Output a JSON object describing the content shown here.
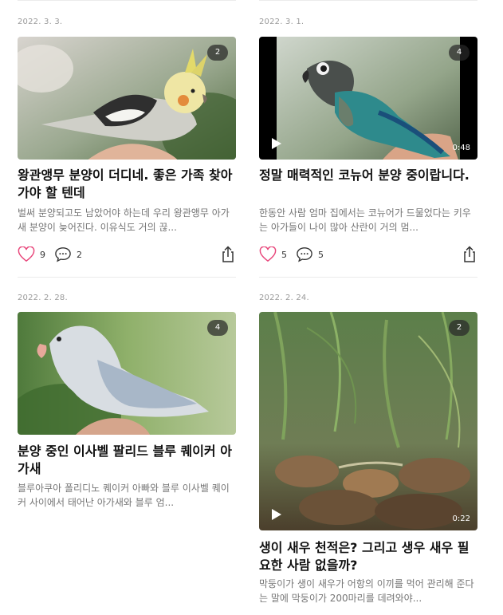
{
  "posts": [
    {
      "date": "2022. 3. 3.",
      "image_count": "2",
      "title": "왕관앵무 분양이 더디네. 좋은 가족 찾아가야 할 텐데",
      "excerpt": "벌써 분양되고도 남았어야 하는데 우리 왕관앵무 아가새 분양이 늦어진다. 이유식도 거의 끊...",
      "likes": "9",
      "comments": "2",
      "is_video": false
    },
    {
      "date": "2022. 3. 1.",
      "image_count": "4",
      "title": "정말 매력적인 코뉴어 분양 중이랍니다.",
      "excerpt": "한동안 사람 엄마 집에서는 코뉴어가 드물었다는 키우는 아가들이 나이 많아 산란이 거의 멈...",
      "likes": "5",
      "comments": "5",
      "is_video": true,
      "duration": "0:48"
    },
    {
      "date": "2022. 2. 28.",
      "image_count": "4",
      "title": "분양 중인 이사벨 팔리드 블루 퀘이커 아가새",
      "excerpt": "블루아쿠아 폴리디노 퀘이커 아빠와 블루 이사벨 퀘이커 사이에서 태어난 아가새와 블루 엄...",
      "is_video": false
    },
    {
      "date": "2022. 2. 24.",
      "image_count": "2",
      "title": "생이 새우 천적은? 그리고 생우 새우 필요한 사람 없을까?",
      "excerpt": "막둥이가 생이 새우가 어항의 이끼를 먹어 관리해 준다는 말에 막둥이가 200마리를 데려와야...",
      "is_video": true,
      "duration": "0:22"
    }
  ],
  "icons": {
    "like": "heart-icon",
    "comment": "speech-bubble-icon",
    "share": "share-icon",
    "play": "play-icon"
  },
  "colors": {
    "like": "#e8457a",
    "text_muted": "#757575",
    "date": "#9a9a9a"
  }
}
